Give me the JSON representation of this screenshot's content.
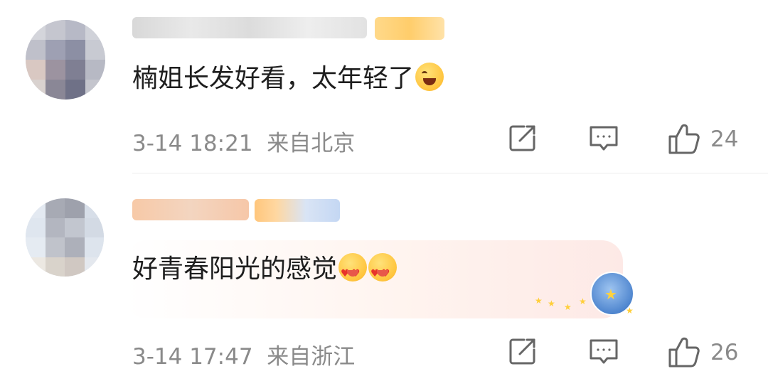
{
  "comments": [
    {
      "text": "楠姐长发好看，太年轻了",
      "emoji_icon": "laughing-emoji",
      "time": "3-14 18:21",
      "location": "来自北京",
      "likes": "24"
    },
    {
      "text": "好青春阳光的感觉",
      "emoji_icon": "heart-eyes-emoji",
      "time": "3-14 17:47",
      "location": "来自浙江",
      "likes": "26"
    }
  ],
  "colors": {
    "meta_text": "#8a8a8a",
    "icon_stroke": "#666666",
    "divider": "#ececec"
  }
}
